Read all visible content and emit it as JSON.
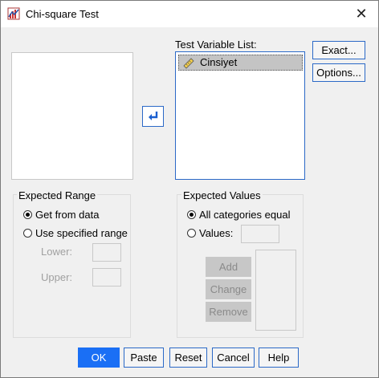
{
  "window": {
    "title": "Chi-square Test",
    "close_glyph": "✕"
  },
  "test_variable_list": {
    "label": "Test Variable List:",
    "items": [
      {
        "label": "Cinsiyet",
        "icon": "ruler-icon"
      }
    ]
  },
  "move_button": {
    "icon": "arrow-left-icon"
  },
  "side_buttons": {
    "exact": "Exact...",
    "options": "Options..."
  },
  "expected_range": {
    "title": "Expected Range",
    "get_from_data": "Get from data",
    "use_specified": "Use specified range",
    "lower_label": "Lower:",
    "upper_label": "Upper:",
    "lower_value": "",
    "upper_value": ""
  },
  "expected_values": {
    "title": "Expected Values",
    "all_equal": "All categories equal",
    "values_label": "Values:",
    "values_input": "",
    "add": "Add",
    "change": "Change",
    "remove": "Remove"
  },
  "bottom_buttons": {
    "ok": "OK",
    "paste": "Paste",
    "reset": "Reset",
    "cancel": "Cancel",
    "help": "Help"
  },
  "colors": {
    "accent": "#1a6ff5",
    "border_active": "#2b69c7",
    "disabled_button": "#c7c7c7"
  }
}
